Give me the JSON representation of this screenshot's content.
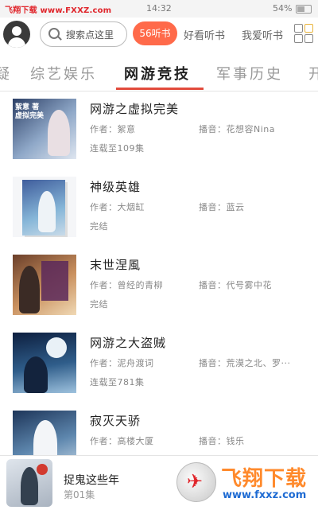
{
  "statusbar": {
    "site": "飞翔下载 www.FXXZ.com",
    "time": "14:32",
    "battery": "54%"
  },
  "header": {
    "search_placeholder": "搜索点这里",
    "pill": "56听书",
    "nav": [
      "好看听书",
      "我爱听书"
    ]
  },
  "tabs": [
    "综艺娱乐",
    "网游竞技",
    "军事历史"
  ],
  "tab_fragments": {
    "left": "疑",
    "right": "开"
  },
  "active_tab": "网游竞技",
  "books": [
    {
      "title": "网游之虚拟完美",
      "author": "作者：絮意",
      "narrator": "播音：花想容Nina",
      "status": "连载至109集",
      "cover_text": "絮意 著 虚拟完美"
    },
    {
      "title": "神级英雄",
      "author": "作者：大烟缸",
      "narrator": "播音：蓝云",
      "status": "完结",
      "cover_text": ""
    },
    {
      "title": "末世涅風",
      "author": "作者：曾经的青柳",
      "narrator": "播音：代号雾中花",
      "status": "完结",
      "cover_text": ""
    },
    {
      "title": "网游之大盗贼",
      "author": "作者：泥舟渡词",
      "narrator": "播音：荒漠之北、罗···",
      "status": "连载至781集",
      "cover_text": ""
    },
    {
      "title": "寂灭天骄",
      "author": "作者：高楼大厦",
      "narrator": "播音：钱乐",
      "status": "",
      "cover_text": ""
    }
  ],
  "player": {
    "title": "捉鬼这些年",
    "episode": "第01集"
  },
  "watermark": {
    "brand": "飞翔下载",
    "url": "www.fxxz.com"
  },
  "colors": {
    "accent": "#e24b3c",
    "pill": "#ff6a4a",
    "watermark_red": "#e0252b",
    "watermark_orange": "#ff8a2c",
    "watermark_blue": "#1e6bd3"
  },
  "icons": [
    "avatar-icon",
    "search-icon",
    "grid-menu-icon",
    "battery-icon"
  ]
}
